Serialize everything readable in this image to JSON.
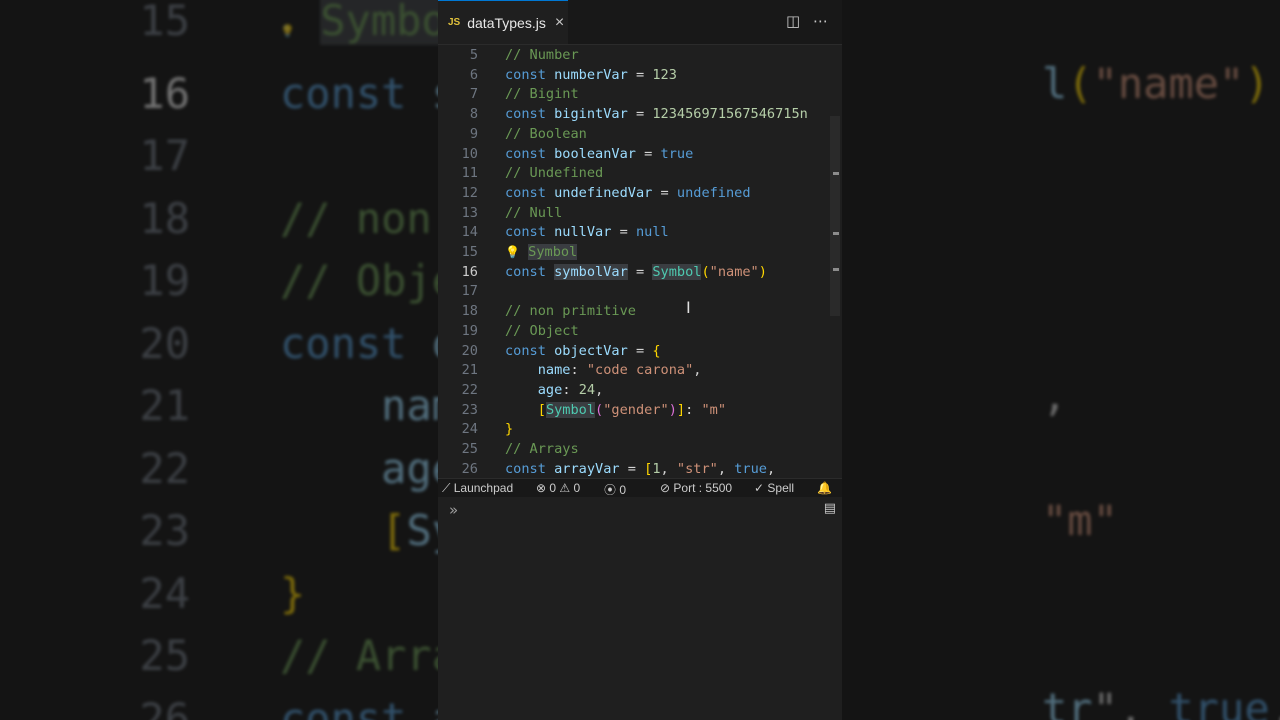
{
  "tab": {
    "lang_badge": "JS",
    "filename": "dataTypes.js",
    "close_glyph": "×"
  },
  "toolbar": {
    "split_icon": "split-editor-icon",
    "more_icon": "more-actions-icon"
  },
  "editor": {
    "current_line": "16",
    "lines": [
      {
        "n": "5",
        "text": "// Number"
      },
      {
        "n": "6",
        "text": "const numberVar = 123"
      },
      {
        "n": "7",
        "text": "// Bigint"
      },
      {
        "n": "8",
        "text": "const bigintVar = 123456971567546715n"
      },
      {
        "n": "9",
        "text": "// Boolean"
      },
      {
        "n": "10",
        "text": "const booleanVar = true"
      },
      {
        "n": "11",
        "text": "// Undefined"
      },
      {
        "n": "12",
        "text": "const undefinedVar = undefined"
      },
      {
        "n": "13",
        "text": "// Null"
      },
      {
        "n": "14",
        "text": "const nullVar = null"
      },
      {
        "n": "15",
        "text": "// Symbol"
      },
      {
        "n": "16",
        "text": "const symbolVar = Symbol(\"name\")"
      },
      {
        "n": "17",
        "text": ""
      },
      {
        "n": "18",
        "text": "// non primitive"
      },
      {
        "n": "19",
        "text": "// Object"
      },
      {
        "n": "20",
        "text": "const objectVar = {"
      },
      {
        "n": "21",
        "text": "    name: \"code carona\","
      },
      {
        "n": "22",
        "text": "    age: 24,"
      },
      {
        "n": "23",
        "text": "    [Symbol(\"gender\")]: \"m\""
      },
      {
        "n": "24",
        "text": "}"
      },
      {
        "n": "25",
        "text": "// Arrays"
      },
      {
        "n": "26",
        "text": "const arrayVar = [1, \"str\", true,"
      }
    ]
  },
  "statusbar": {
    "launchpad": "Launchpad",
    "errors": "0",
    "warnings": "0",
    "ports": "0",
    "port_label": "Port : 5500",
    "spell": "Spell"
  },
  "terminal": {
    "prompt_icon": "chevron-double-right-icon"
  },
  "background": {
    "left_lines": [
      {
        "n": "15",
        "text": "// Symbol"
      },
      {
        "n": "16",
        "text": "const sym"
      },
      {
        "n": "17",
        "text": ""
      },
      {
        "n": "18",
        "text": "// non p"
      },
      {
        "n": "19",
        "text": "// Objec"
      },
      {
        "n": "20",
        "text": "const obj"
      },
      {
        "n": "21",
        "text": "    name"
      },
      {
        "n": "22",
        "text": "    age:"
      },
      {
        "n": "23",
        "text": "    [Symb"
      },
      {
        "n": "24",
        "text": "}"
      },
      {
        "n": "25",
        "text": "// Arrays"
      },
      {
        "n": "26",
        "text": "const ar"
      }
    ],
    "right_lines": [
      {
        "text": ""
      },
      {
        "text": "l(\"name\")"
      },
      {
        "text": ""
      },
      {
        "text": ""
      },
      {
        "text": ""
      },
      {
        "text": ""
      },
      {
        "text": ","
      },
      {
        "text": ""
      },
      {
        "text": "\"m\""
      },
      {
        "text": ""
      },
      {
        "text": ""
      },
      {
        "text": "tr\", true,"
      }
    ]
  }
}
